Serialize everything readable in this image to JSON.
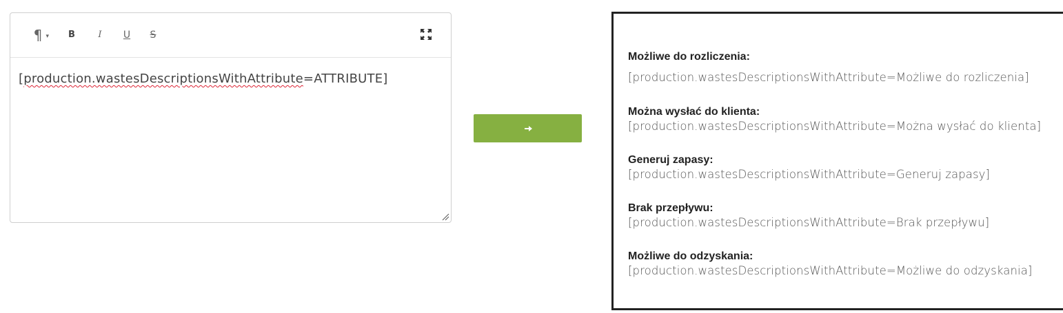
{
  "editor": {
    "toolbar": {
      "paragraph_icon": "pilcrow-icon",
      "bold_label": "B",
      "italic_label": "I",
      "underline_label": "U",
      "strike_label": "S",
      "fullscreen_icon": "expand-icon"
    },
    "content_prefix": "[",
    "content_squiggle": "production.wastesDescriptionsWithAttribute",
    "content_suffix": "=ATTRIBUTE]"
  },
  "convert_button": {
    "icon": "arrow-right-icon",
    "color": "#86b041"
  },
  "preview": {
    "items": [
      {
        "label": "Możliwe do rozliczenia:",
        "value": "[production.wastesDescriptionsWithAttribute=Możliwe do rozliczenia]"
      },
      {
        "label": "Można wysłać do klienta:",
        "value": "[production.wastesDescriptionsWithAttribute=Można wysłać do klienta]"
      },
      {
        "label": "Generuj zapasy:",
        "value": "[production.wastesDescriptionsWithAttribute=Generuj zapasy]"
      },
      {
        "label": "Brak przepływu:",
        "value": "[production.wastesDescriptionsWithAttribute=Brak przepływu]"
      },
      {
        "label": "Możliwe do odzyskania:",
        "value": "[production.wastesDescriptionsWithAttribute=Możliwe do odzyskania]"
      }
    ]
  }
}
